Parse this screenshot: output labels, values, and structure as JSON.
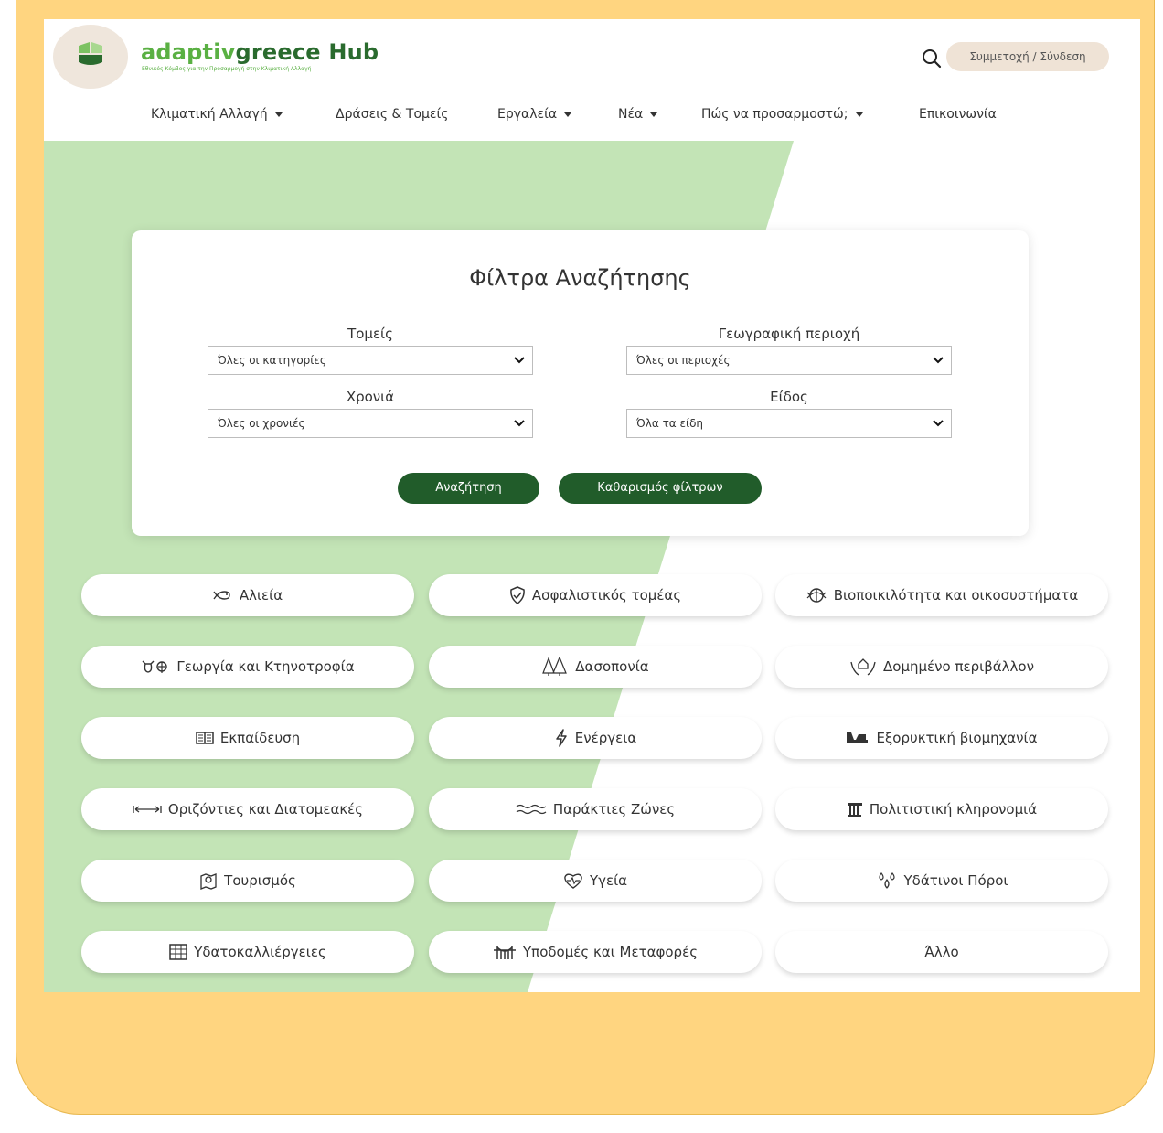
{
  "header": {
    "brand_a": "adaptiv",
    "brand_g": "greece",
    "brand_hub": " Hub",
    "tagline": "Εθνικός Κόμβος για την Προσαρμογή στην Κλιματική Αλλαγή",
    "login_label": "Συμμετοχή / Σύνδεση"
  },
  "nav": [
    {
      "label": "Κλιματική Αλλαγή",
      "dropdown": true
    },
    {
      "label": "Δράσεις & Τομείς",
      "dropdown": false
    },
    {
      "label": "Εργαλεία",
      "dropdown": true
    },
    {
      "label": "Νέα",
      "dropdown": true
    },
    {
      "label": "Πώς να προσαρμοστώ;",
      "dropdown": true
    },
    {
      "label": "Επικοινωνία",
      "dropdown": false
    }
  ],
  "filters": {
    "title": "Φίλτρα Αναζήτησης",
    "sectors_label": "Τομείς",
    "sectors_value": "Όλες οι κατηγορίες",
    "region_label": "Γεωγραφική περιοχή",
    "region_value": "Όλες οι περιοχές",
    "year_label": "Χρονιά",
    "year_value": "Όλες οι χρονιές",
    "type_label": "Είδος",
    "type_value": "Όλα τα είδη",
    "search_label": "Αναζήτηση",
    "clear_label": "Καθαρισμός φίλτρων"
  },
  "sectors": [
    {
      "label": "Αλιεία",
      "icon": "fish-icon"
    },
    {
      "label": "Ασφαλιστικός τομέας",
      "icon": "shield-check-icon"
    },
    {
      "label": "Βιοποικιλότητα και οικοσυστήματα",
      "icon": "ecosystem-icon"
    },
    {
      "label": "Γεωργία και Κτηνοτροφία",
      "icon": "cow-plant-icon"
    },
    {
      "label": "Δασοπονία",
      "icon": "trees-icon"
    },
    {
      "label": "Δομημένο περιβάλλον",
      "icon": "hands-house-icon"
    },
    {
      "label": "Εκπαίδευση",
      "icon": "book-icon"
    },
    {
      "label": "Ενέργεια",
      "icon": "lightning-icon"
    },
    {
      "label": "Εξορυκτική βιομηχανία",
      "icon": "mining-truck-icon"
    },
    {
      "label": "Οριζόντιες και Διατομεακές",
      "icon": "horizontal-arrows-icon"
    },
    {
      "label": "Παράκτιες Ζώνες",
      "icon": "waves-icon"
    },
    {
      "label": "Πολιτιστική κληρονομιά",
      "icon": "column-icon"
    },
    {
      "label": "Τουρισμός",
      "icon": "map-pin-icon"
    },
    {
      "label": "Υγεία",
      "icon": "heart-pulse-icon"
    },
    {
      "label": "Υδάτινοι Πόροι",
      "icon": "water-drops-icon"
    },
    {
      "label": "Υδατοκαλλιέργειες",
      "icon": "aquaculture-grid-icon"
    },
    {
      "label": "Υποδομές και Μεταφορές",
      "icon": "bridge-icon"
    },
    {
      "label": "Άλλο",
      "icon": ""
    }
  ],
  "colors": {
    "frame": "#ffd580",
    "green_bg": "#c3e4b6",
    "button": "#215c2a",
    "brand_light": "#5ab043",
    "brand_dark": "#2a6b2e"
  }
}
